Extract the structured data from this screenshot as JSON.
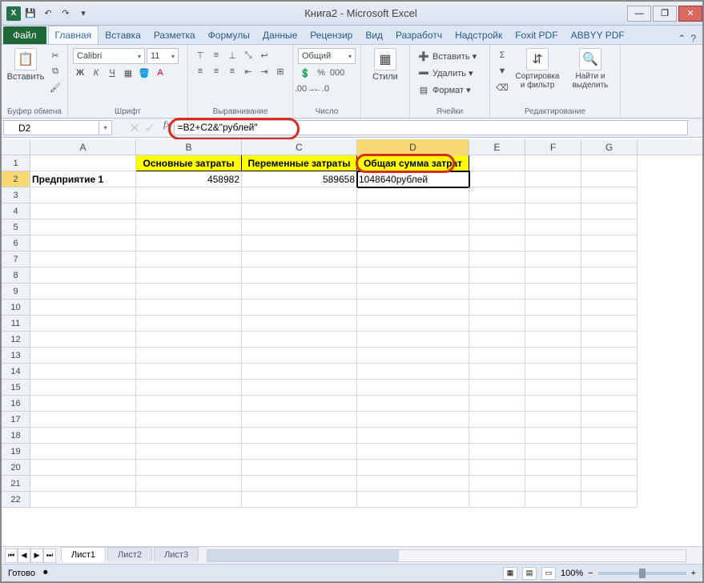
{
  "title": "Книга2 - Microsoft Excel",
  "qat": {
    "save": "💾",
    "undo": "↶",
    "redo": "↷",
    "dd": "▾"
  },
  "tabs": {
    "file": "Файл",
    "list": [
      "Главная",
      "Вставка",
      "Разметка",
      "Формулы",
      "Данные",
      "Рецензир",
      "Вид",
      "Разработч",
      "Надстройк",
      "Foxit PDF",
      "ABBYY PDF"
    ],
    "active_index": 0
  },
  "ribbon": {
    "clipboard": {
      "paste": "Вставить",
      "label": "Буфер обмена"
    },
    "font": {
      "name": "Calibri",
      "size": "11",
      "label": "Шрифт"
    },
    "align": {
      "label": "Выравнивание"
    },
    "number": {
      "format": "Общий",
      "label": "Число"
    },
    "styles": {
      "btn": "Стили"
    },
    "cells": {
      "insert": "Вставить ▾",
      "delete": "Удалить ▾",
      "format": "Формат ▾",
      "label": "Ячейки"
    },
    "editing": {
      "sort": "Сортировка и фильтр",
      "find": "Найти и выделить",
      "label": "Редактирование"
    }
  },
  "name_box": "D2",
  "formula": "=B2+C2&\"рублей\"",
  "columns": [
    "A",
    "B",
    "C",
    "D",
    "E",
    "F",
    "G"
  ],
  "headers": {
    "b": "Основные затраты",
    "c": "Переменные затраты",
    "d": "Общая сумма затрат"
  },
  "row1": {
    "a": "Предприятие 1",
    "b": "458982",
    "c": "589658",
    "d": "1048640рублей"
  },
  "row_count": 22,
  "sheets": {
    "list": [
      "Лист1",
      "Лист2",
      "Лист3"
    ],
    "active": 0
  },
  "status": {
    "ready": "Готово",
    "zoom": "100%"
  }
}
